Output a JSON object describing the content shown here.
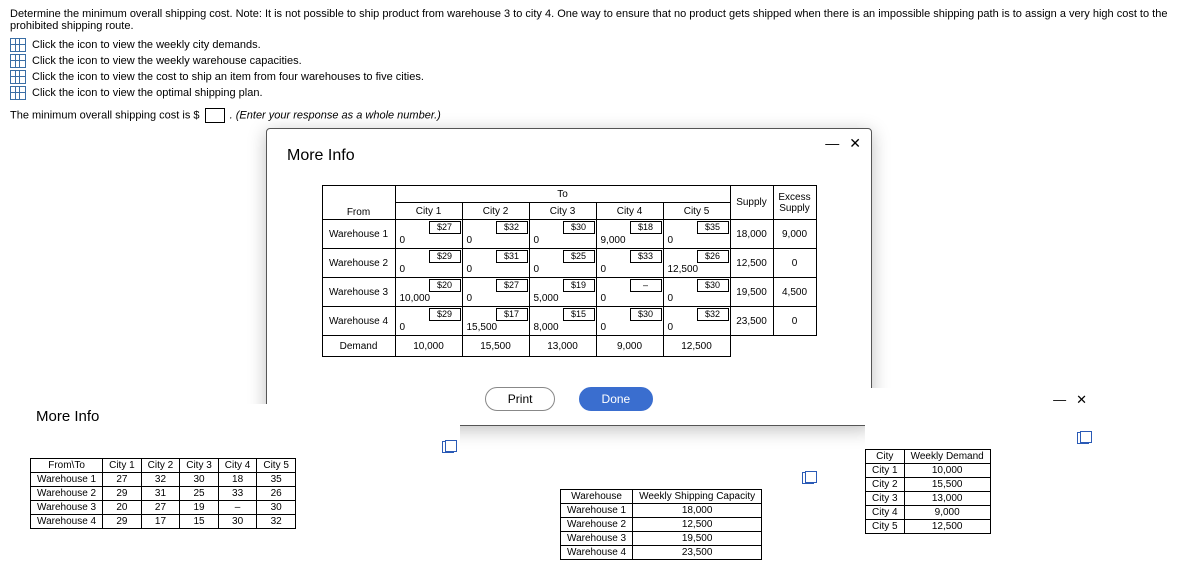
{
  "intro": "Determine the minimum overall shipping cost. Note: It is not possible to ship product from warehouse 3 to city 4. One way to ensure that no product gets shipped when there is an impossible shipping path is to assign a very high cost to the prohibited shipping route.",
  "links": {
    "l1": "Click the icon to view the weekly city demands.",
    "l2": "Click the icon to view the weekly warehouse capacities.",
    "l3": "Click the icon to view the cost to ship an item from four warehouses to five cities.",
    "l4": "Click the icon to view the optimal shipping plan."
  },
  "answer_prefix": "The minimum overall shipping cost is $",
  "answer_hint": ". (Enter your response as a whole number.)",
  "modal_title": "More Info",
  "to_label": "To",
  "from_label": "From",
  "cols": [
    "City 1",
    "City 2",
    "City 3",
    "City 4",
    "City 5"
  ],
  "supply_label": "Supply",
  "excess_label": "Excess\nSupply",
  "rows": [
    "Warehouse 1",
    "Warehouse 2",
    "Warehouse 3",
    "Warehouse 4"
  ],
  "demand_label": "Demand",
  "costs": [
    [
      "$27",
      "$32",
      "$30",
      "$18",
      "$35"
    ],
    [
      "$29",
      "$31",
      "$25",
      "$33",
      "$26"
    ],
    [
      "$20",
      "$27",
      "$19",
      "–",
      "$30"
    ],
    [
      "$29",
      "$17",
      "$15",
      "$30",
      "$32"
    ]
  ],
  "flows": [
    [
      "0",
      "0",
      "0",
      "9,000",
      "0"
    ],
    [
      "0",
      "0",
      "0",
      "0",
      "12,500"
    ],
    [
      "10,000",
      "0",
      "5,000",
      "0",
      "0"
    ],
    [
      "0",
      "15,500",
      "8,000",
      "0",
      "0"
    ]
  ],
  "supply": [
    "18,000",
    "12,500",
    "19,500",
    "23,500"
  ],
  "excess": [
    "9,000",
    "0",
    "4,500",
    "0"
  ],
  "demand": [
    "10,000",
    "15,500",
    "13,000",
    "9,000",
    "12,500"
  ],
  "print_btn": "Print",
  "done_btn": "Done",
  "mini_cost": {
    "title": "More Info",
    "head": [
      "From\\To",
      "City 1",
      "City 2",
      "City 3",
      "City 4",
      "City 5"
    ],
    "rows": [
      [
        "Warehouse 1",
        "27",
        "32",
        "30",
        "18",
        "35"
      ],
      [
        "Warehouse 2",
        "29",
        "31",
        "25",
        "33",
        "26"
      ],
      [
        "Warehouse 3",
        "20",
        "27",
        "19",
        "–",
        "30"
      ],
      [
        "Warehouse 4",
        "29",
        "17",
        "15",
        "30",
        "32"
      ]
    ]
  },
  "mini_cap": {
    "head": [
      "Warehouse",
      "Weekly Shipping Capacity"
    ],
    "rows": [
      [
        "Warehouse 1",
        "18,000"
      ],
      [
        "Warehouse 2",
        "12,500"
      ],
      [
        "Warehouse 3",
        "19,500"
      ],
      [
        "Warehouse 4",
        "23,500"
      ]
    ]
  },
  "mini_dem": {
    "head": [
      "City",
      "Weekly Demand"
    ],
    "rows": [
      [
        "City 1",
        "10,000"
      ],
      [
        "City 2",
        "15,500"
      ],
      [
        "City 3",
        "13,000"
      ],
      [
        "City 4",
        "9,000"
      ],
      [
        "City 5",
        "12,500"
      ]
    ]
  }
}
